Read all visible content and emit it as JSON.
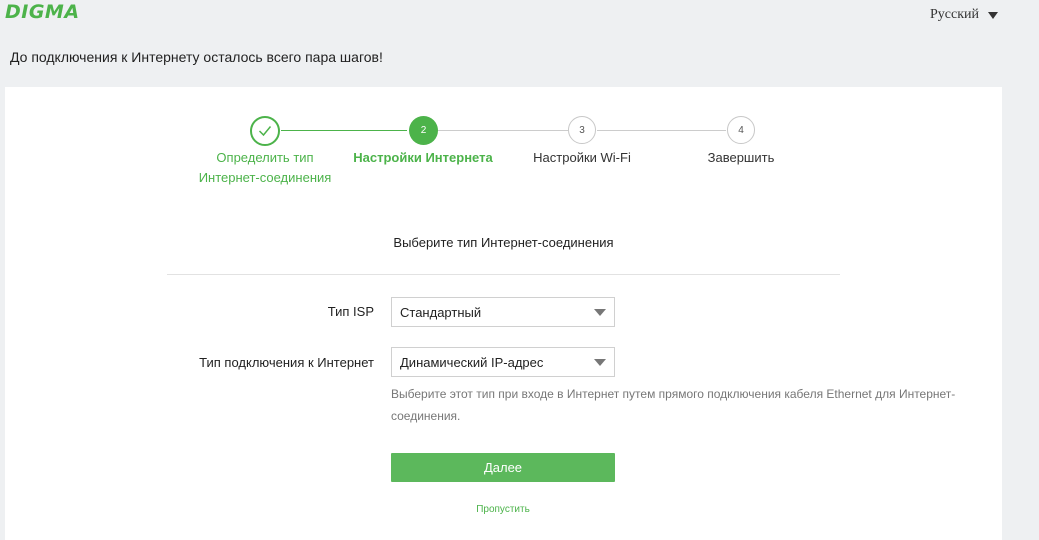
{
  "header": {
    "logo": "DIGMA",
    "language": {
      "selected": "Русский"
    }
  },
  "intro": "До подключения к Интернету осталось всего пара шагов!",
  "wizard": {
    "steps": [
      {
        "number": "1",
        "label_line1": "Определить тип",
        "label_line2": "Интернет-соединения",
        "state": "done"
      },
      {
        "number": "2",
        "label_line1": "Настройки Интернета",
        "state": "active"
      },
      {
        "number": "3",
        "label_line1": "Настройки Wi-Fi",
        "state": "todo"
      },
      {
        "number": "4",
        "label_line1": "Завершить",
        "state": "todo"
      }
    ]
  },
  "form": {
    "title": "Выберите тип Интернет-соединения",
    "isp_type": {
      "label": "Тип ISP",
      "value": "Стандартный"
    },
    "connection_type": {
      "label": "Тип подключения к Интернет",
      "value": "Динамический IP-адрес"
    },
    "hint": "Выберите этот тип при входе в Интернет путем прямого подключения кабеля Ethernet для Интернет-соединения.",
    "next_button": "Далее",
    "skip_link": "Пропустить"
  },
  "colors": {
    "accent": "#4cb34a",
    "button": "#5cb85c",
    "background": "#eef0f2",
    "inactive_line": "#cccccc"
  },
  "icons": {
    "step1_done": "checkmark-icon",
    "select_caret": "caret-down-icon",
    "language_caret": "caret-down-icon"
  }
}
